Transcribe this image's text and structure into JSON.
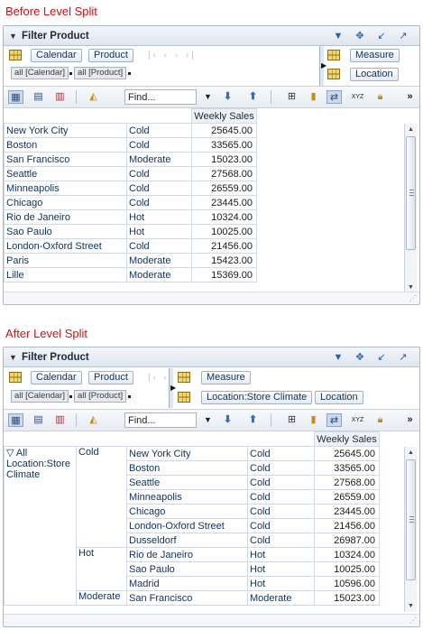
{
  "before": {
    "caption": "Before Level Split",
    "panel_title": "Filter Product",
    "layout": {
      "page_buttons": [
        "Calendar",
        "Product"
      ],
      "page_chips": [
        "all [Calendar]",
        "all [Product]"
      ],
      "right_buttons": [
        "Measure",
        "Location"
      ]
    },
    "toolbar": {
      "find_placeholder": "Find..."
    },
    "grid": {
      "header": "Weekly Sales",
      "rows": [
        {
          "city": "New York City",
          "climate": "Cold",
          "sales": "25645.00"
        },
        {
          "city": "Boston",
          "climate": "Cold",
          "sales": "33565.00"
        },
        {
          "city": "San Francisco",
          "climate": "Moderate",
          "sales": "15023.00"
        },
        {
          "city": "Seattle",
          "climate": "Cold",
          "sales": "27568.00"
        },
        {
          "city": "Minneapolis",
          "climate": "Cold",
          "sales": "26559.00"
        },
        {
          "city": "Chicago",
          "climate": "Cold",
          "sales": "23445.00"
        },
        {
          "city": "Rio de Janeiro",
          "climate": "Hot",
          "sales": "10324.00"
        },
        {
          "city": "Sao Paulo",
          "climate": "Hot",
          "sales": "10025.00"
        },
        {
          "city": "London-Oxford Street",
          "climate": "Cold",
          "sales": "21456.00"
        },
        {
          "city": "Paris",
          "climate": "Moderate",
          "sales": "15423.00"
        },
        {
          "city": "Lille",
          "climate": "Moderate",
          "sales": "15369.00"
        }
      ]
    }
  },
  "after": {
    "caption": "After Level Split",
    "panel_title": "Filter Product",
    "layout": {
      "page_buttons": [
        "Calendar",
        "Product"
      ],
      "page_chips": [
        "all [Calendar]",
        "all [Product]"
      ],
      "right_buttons": [
        "Measure",
        "Location:Store Climate",
        "Location"
      ]
    },
    "toolbar": {
      "find_placeholder": "Find..."
    },
    "grid": {
      "header": "Weekly Sales",
      "outer_label": "▽ All Location:Store Climate",
      "groups": [
        {
          "climate": "Cold",
          "rows": [
            {
              "city": "New York City",
              "climate": "Cold",
              "sales": "25645.00"
            },
            {
              "city": "Boston",
              "climate": "Cold",
              "sales": "33565.00"
            },
            {
              "city": "Seattle",
              "climate": "Cold",
              "sales": "27568.00"
            },
            {
              "city": "Minneapolis",
              "climate": "Cold",
              "sales": "26559.00"
            },
            {
              "city": "Chicago",
              "climate": "Cold",
              "sales": "23445.00"
            },
            {
              "city": "London-Oxford Street",
              "climate": "Cold",
              "sales": "21456.00"
            },
            {
              "city": "Dusseldorf",
              "climate": "Cold",
              "sales": "26987.00"
            }
          ]
        },
        {
          "climate": "Hot",
          "rows": [
            {
              "city": "Rio de Janeiro",
              "climate": "Hot",
              "sales": "10324.00"
            },
            {
              "city": "Sao Paulo",
              "climate": "Hot",
              "sales": "10025.00"
            },
            {
              "city": "Madrid",
              "climate": "Hot",
              "sales": "10596.00"
            }
          ]
        },
        {
          "climate": "Moderate",
          "rows": [
            {
              "city": "San Francisco",
              "climate": "Moderate",
              "sales": "15023.00"
            }
          ]
        }
      ]
    }
  },
  "icons": {
    "collapse": "chevron-down-icon",
    "header_menu": "triangle-down-icon",
    "move": "move-icon",
    "shrink": "shrink-icon",
    "expand": "expand-icon",
    "nav": "nav-arrows-icon",
    "find_dropdown": "triangle-down-icon",
    "find_next": "arrow-down-icon",
    "find_prev": "arrow-up-icon",
    "more": "double-chevron-right-icon"
  },
  "colors": {
    "caption": "#d01010",
    "button_text": "#10305a",
    "panel_border": "#a9b8cc"
  }
}
